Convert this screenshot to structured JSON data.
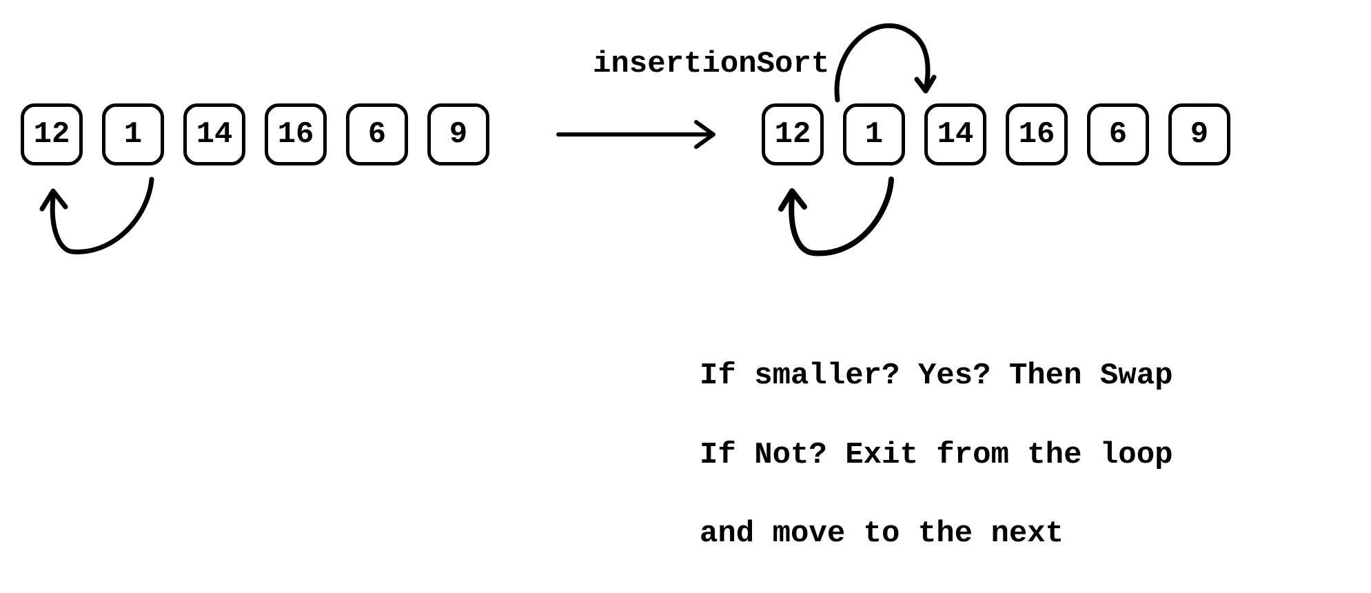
{
  "algorithm_name": "insertionSort",
  "left_array": [
    "12",
    "1",
    "14",
    "16",
    "6",
    "9"
  ],
  "right_array": [
    "12",
    "1",
    "14",
    "16",
    "6",
    "9"
  ],
  "explanation_lines": [
    "If smaller? Yes? Then Swap",
    "If Not? Exit from the loop",
    "and move to the next"
  ]
}
